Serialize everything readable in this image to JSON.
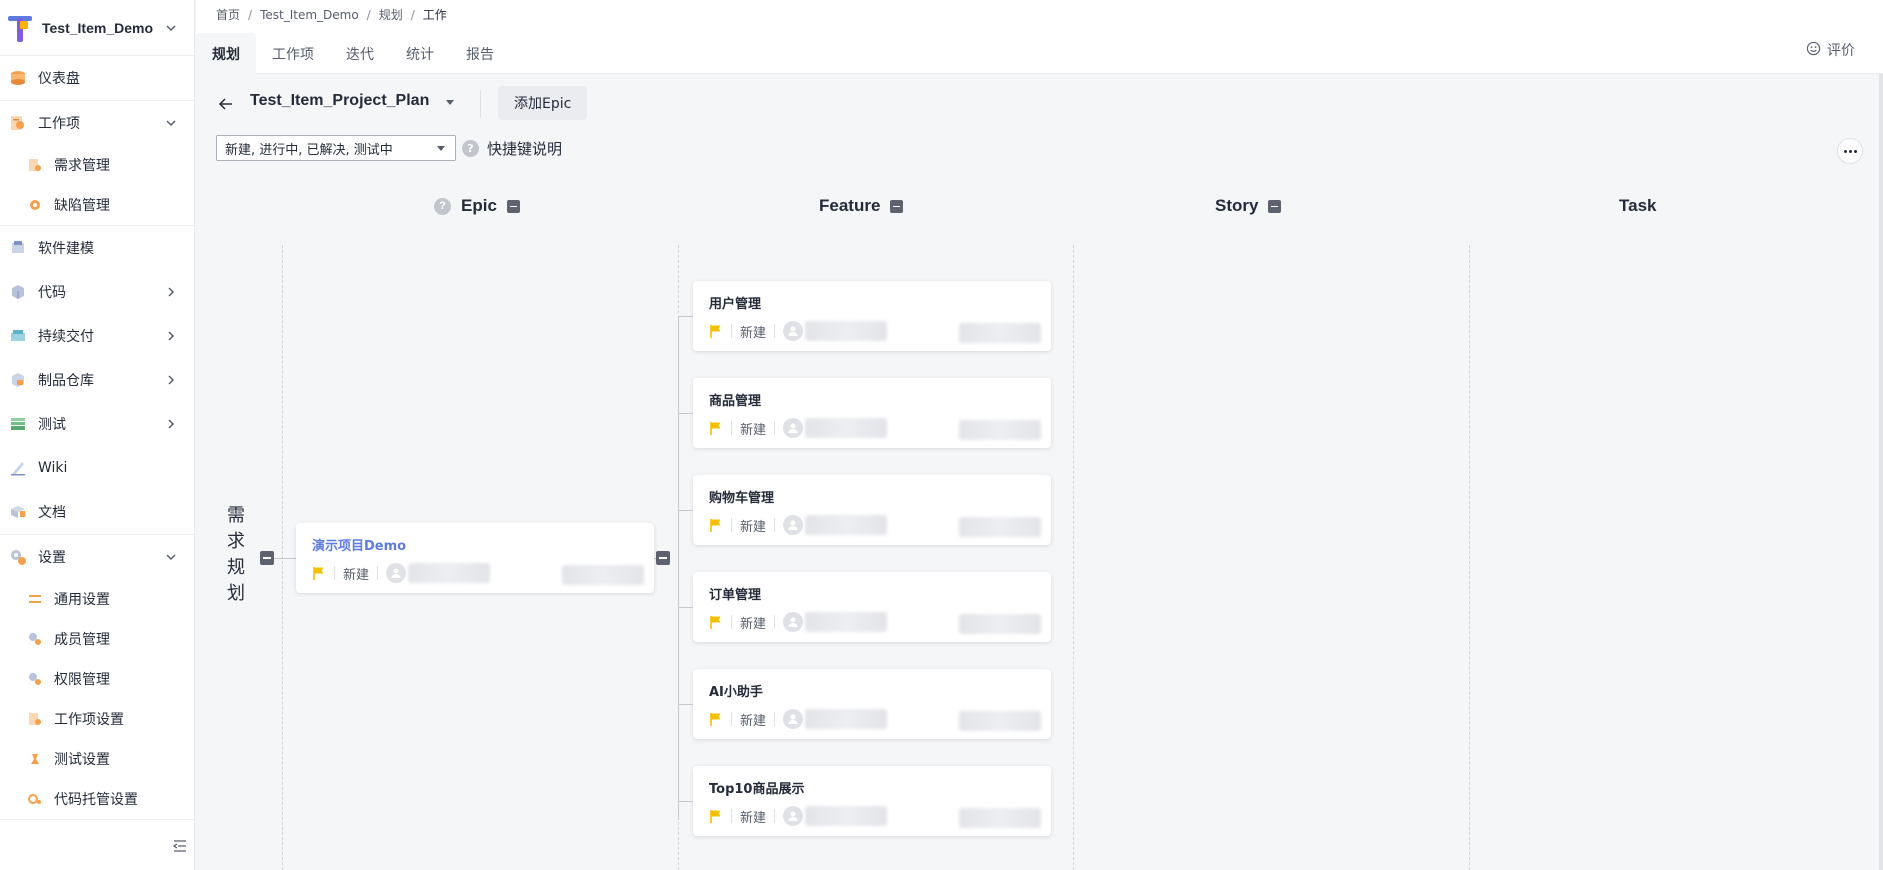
{
  "project": {
    "name": "Test_Item_Demo"
  },
  "sidebar": {
    "items": [
      {
        "label": "仪表盘",
        "icon": "dashboard-icon"
      },
      {
        "label": "工作项",
        "icon": "work-item-icon",
        "expanded": true,
        "children": [
          {
            "label": "需求管理",
            "icon": "requirement-icon"
          },
          {
            "label": "缺陷管理",
            "icon": "defect-icon"
          }
        ]
      },
      {
        "label": "软件建模",
        "icon": "modeling-icon"
      },
      {
        "label": "代码",
        "icon": "code-icon"
      },
      {
        "label": "持续交付",
        "icon": "delivery-icon"
      },
      {
        "label": "制品仓库",
        "icon": "artifact-icon"
      },
      {
        "label": "测试",
        "icon": "test-icon"
      },
      {
        "label": "Wiki",
        "icon": "wiki-icon"
      },
      {
        "label": "文档",
        "icon": "docs-icon"
      },
      {
        "label": "设置",
        "icon": "settings-icon",
        "expanded": true,
        "children": [
          {
            "label": "通用设置"
          },
          {
            "label": "成员管理"
          },
          {
            "label": "权限管理"
          },
          {
            "label": "工作项设置"
          },
          {
            "label": "测试设置"
          },
          {
            "label": "代码托管设置"
          }
        ]
      }
    ]
  },
  "breadcrumb": {
    "items": [
      "首页",
      "Test_Item_Demo",
      "规划",
      "工作"
    ],
    "sep": "/"
  },
  "tabs": [
    {
      "label": "规划",
      "active": true
    },
    {
      "label": "工作项"
    },
    {
      "label": "迭代"
    },
    {
      "label": "统计"
    },
    {
      "label": "报告"
    }
  ],
  "feedback": {
    "label": "评价"
  },
  "toolbar": {
    "plan_title": "Test_Item_Project_Plan",
    "add_epic": "添加Epic"
  },
  "filter": {
    "value": "新建, 进行中, 已解决, 测试中",
    "help": "?",
    "shortcut_label": "快捷键说明"
  },
  "columns": [
    {
      "label": "Epic",
      "help": "?"
    },
    {
      "label": "Feature"
    },
    {
      "label": "Story"
    },
    {
      "label": "Task"
    }
  ],
  "row_label": [
    "需",
    "求",
    "规",
    "划"
  ],
  "epic": {
    "title": "演示项目Demo",
    "status": "新建"
  },
  "features": [
    {
      "title": "用户管理",
      "status": "新建"
    },
    {
      "title": "商品管理",
      "status": "新建"
    },
    {
      "title": "购物车管理",
      "status": "新建"
    },
    {
      "title": "订单管理",
      "status": "新建"
    },
    {
      "title": "AI小助手",
      "status": "新建"
    },
    {
      "title": "Top10商品展示",
      "status": "新建"
    }
  ],
  "colors": {
    "accent": "#5e7ce0",
    "flag": "#f6c000",
    "bg": "#f5f6f8"
  }
}
